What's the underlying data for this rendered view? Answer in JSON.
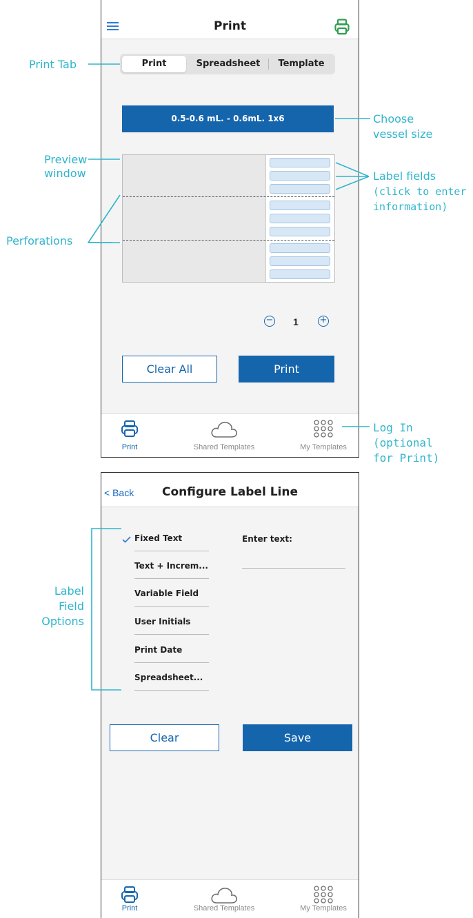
{
  "screen1": {
    "title": "Print",
    "tabs": [
      {
        "label": "Print",
        "active": true
      },
      {
        "label": "Spreadsheet",
        "active": false
      },
      {
        "label": "Template",
        "active": false
      }
    ],
    "vessel_button": "0.5-0.6 mL. - 0.6mL.  1x6",
    "quantity": "1",
    "stepper_minus": "−",
    "stepper_plus": "+",
    "clear_all_label": "Clear All",
    "print_label": "Print",
    "bottom_tabs": [
      {
        "label": "Print",
        "icon": "printer-icon",
        "active": true
      },
      {
        "label": "Shared Templates",
        "icon": "cloud-icon",
        "active": false
      },
      {
        "label": "My Templates",
        "icon": "grid-dots-icon",
        "active": false
      }
    ]
  },
  "screen2": {
    "back_label": "< Back",
    "title": "Configure Label Line",
    "options": [
      {
        "label": "Fixed Text",
        "selected": true
      },
      {
        "label": "Text + Increm...",
        "selected": false
      },
      {
        "label": "Variable Field",
        "selected": false
      },
      {
        "label": "User Initials",
        "selected": false
      },
      {
        "label": "Print Date",
        "selected": false
      },
      {
        "label": "Spreadsheet...",
        "selected": false
      }
    ],
    "enter_text_label": "Enter text:",
    "enter_text_value": "",
    "clear_label": "Clear",
    "save_label": "Save",
    "bottom_tabs": [
      {
        "label": "Print",
        "icon": "printer-icon",
        "active": true
      },
      {
        "label": "Shared Templates",
        "icon": "cloud-icon",
        "active": false
      },
      {
        "label": "My Templates",
        "icon": "grid-dots-icon",
        "active": false
      }
    ]
  },
  "annotations": {
    "print_tab": "Print Tab",
    "preview_window_1": "Preview",
    "preview_window_2": "window",
    "perforations": "Perforations",
    "vessel_1": "Choose",
    "vessel_2": "vessel size",
    "label_fields_1": "Label fields",
    "label_fields_2": "(click to enter",
    "label_fields_3": "information)",
    "login_1": "Log In",
    "login_2": "(optional",
    "login_3": "for Print)",
    "label_field_options_1": "Label",
    "label_field_options_2": "Field",
    "label_field_options_3": "Options"
  },
  "colors": {
    "brand_blue": "#1565ad",
    "annotation_cyan": "#2fb5cc",
    "printer_green": "#2e9e4f"
  }
}
